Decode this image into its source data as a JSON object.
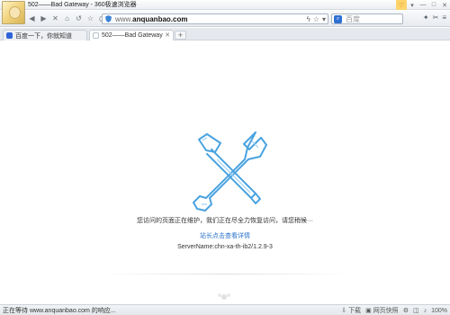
{
  "window": {
    "title": "502——Bad Gateway - 360极速浏览器"
  },
  "nav": {
    "address_prefix": "www.",
    "address_host": "anquanbao.com",
    "search_placeholder": "百度"
  },
  "tabs": [
    {
      "label": "百度一下，你就知道",
      "icon": "baidu-icon"
    },
    {
      "label": "502——Bad Gateway",
      "icon": "page-icon"
    }
  ],
  "page": {
    "maintenance_text": "您访问的页面正在维护，我们正在尽全力恢复访问，请您稍候···",
    "detail_link": "站长点击查看详情",
    "server_name": "ServerName:chn-xa-th-ib2/1.2.9-3"
  },
  "status": {
    "loading_text": "正在等待 www.anquanbao.com 的响应...",
    "download_label": "下载",
    "webshot_label": "网页快照",
    "zoom_label": "100%"
  },
  "colors": {
    "illustration_stroke": "#4aa3e0",
    "link": "#2a73c9",
    "shield": "#3a84d5"
  }
}
